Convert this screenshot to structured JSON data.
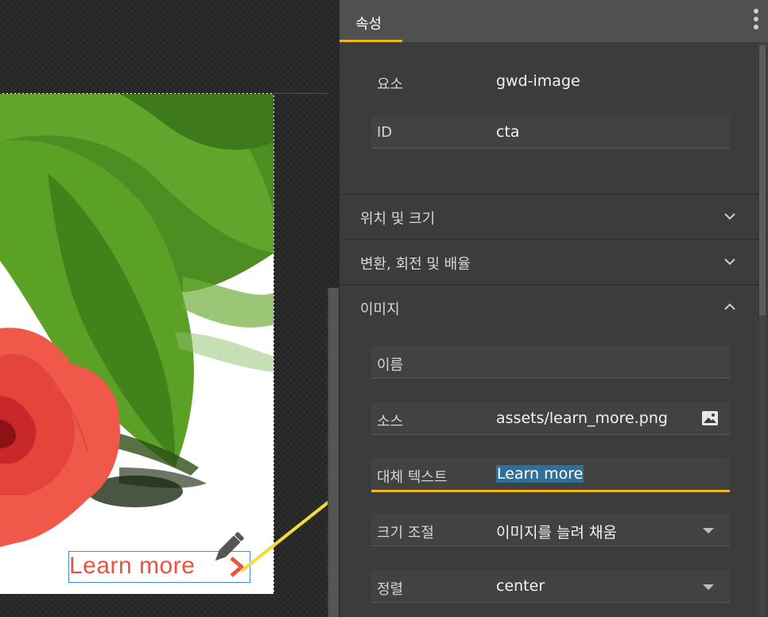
{
  "panel": {
    "tab_label": "속성",
    "menu_icon": "more-vert-icon",
    "element": {
      "label": "요소",
      "value": "gwd-image"
    },
    "id": {
      "label": "ID",
      "value": "cta"
    },
    "sections": {
      "position": {
        "label": "위치 및 크기",
        "state": "collapsed"
      },
      "transform": {
        "label": "변환, 회전 및 배율",
        "state": "collapsed"
      },
      "image": {
        "label": "이미지",
        "state": "expanded"
      }
    },
    "image_fields": {
      "name": {
        "label": "이름",
        "value": ""
      },
      "source": {
        "label": "소스",
        "value": "assets/learn_more.png",
        "icon": "image-picker-icon"
      },
      "alt": {
        "label": "대체 텍스트",
        "value": "Learn more"
      },
      "scaling": {
        "label": "크기 조절",
        "value": "이미지를 늘려 채움"
      },
      "alignment": {
        "label": "정렬",
        "value": "center"
      }
    }
  },
  "stage": {
    "cta_text": "Learn more"
  },
  "colors": {
    "accent": "#f2b51e",
    "selection_border": "#3b8be8",
    "cta_text": "#e9533f",
    "text_highlight": "#2f6f98",
    "arrow": "#f3dc3a"
  }
}
